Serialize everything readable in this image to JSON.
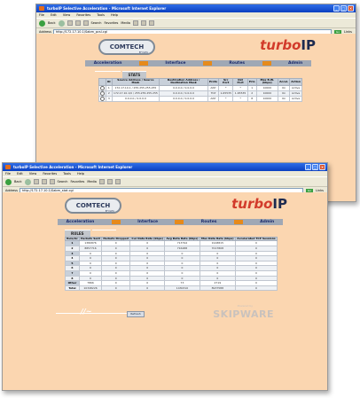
{
  "browser": {
    "title": "turboIP Selective Acceleration - Microsoft Internet Explorer",
    "menu": [
      "File",
      "Edit",
      "View",
      "Favorites",
      "Tools",
      "Help"
    ],
    "toolbar": {
      "back": "Back",
      "search": "Search",
      "favorites": "Favorites",
      "media": "Media"
    },
    "address_label": "Address",
    "go_label": "Go",
    "links_label": "Links"
  },
  "back_window": {
    "url": "http://172.17.10.1/Sabm_pcsl.cgi",
    "nav": [
      "Acceleration",
      "Interface",
      "Routes",
      "Admin"
    ],
    "tabs": [
      "RULES",
      "STATS"
    ],
    "columns": [
      "",
      "ID",
      "Source Address / Source Mask",
      "Destination Address / Destination Mask",
      "Proto",
      "Src Port",
      "Dst Port",
      "Prio",
      "Max B.W. (kbps)",
      "Accel.",
      "Action"
    ],
    "rows": [
      [
        "1",
        "172.17.10.1 / 255.255.255.255",
        "0.0.0.0 / 0.0.0.0",
        "ANY",
        "*",
        "*",
        "1",
        "10000",
        "On",
        "Active"
      ],
      [
        "2",
        "172.17.10.1/0 / 255.255.255.255",
        "0.0.0.0 / 0.0.0.0",
        "TCP",
        "1-65535",
        "1-65535",
        "2",
        "10000",
        "On",
        "Active"
      ],
      [
        "3",
        "0.0.0.0 / 0.0.0.0",
        "0.0.0.0 / 0.0.0.0",
        "ANY",
        "*",
        "*",
        "8",
        "10000",
        "On",
        "Active"
      ]
    ]
  },
  "front_window": {
    "url": "http://172.17.10.1/Sabm_stat.cgi",
    "nav": [
      "Acceleration",
      "Interface",
      "Routes",
      "Admin"
    ],
    "tabs": [
      "RULES",
      "STATS"
    ],
    "columns": [
      "Rule/Ac",
      "Packets Sent",
      "Packets Dropped",
      "Cur Data Rate (kbps)",
      "Avg Data Rate (kbps)",
      "Max Data Rate (kbps)",
      "Accelerated TCP Sessions"
    ],
    "rows": [
      [
        "1",
        "1380876",
        "0",
        "0",
        "713794",
        "1918815",
        "0"
      ],
      [
        "2",
        "8857716",
        "0",
        "0",
        "716488",
        "7017808",
        "0"
      ],
      [
        "3",
        "0",
        "0",
        "0",
        "0",
        "0",
        "0"
      ],
      [
        "4",
        "0",
        "0",
        "0",
        "0",
        "0",
        "0"
      ],
      [
        "5",
        "0",
        "0",
        "0",
        "0",
        "0",
        "0"
      ],
      [
        "6",
        "0",
        "0",
        "0",
        "0",
        "0",
        "0"
      ],
      [
        "7",
        "0",
        "0",
        "0",
        "0",
        "0",
        "0"
      ],
      [
        "8",
        "0",
        "0",
        "0",
        "0",
        "0",
        "0"
      ],
      [
        "Other",
        "7866",
        "0",
        "0",
        "73",
        "2719",
        "0"
      ],
      [
        "Total",
        "10348226",
        "0",
        "0",
        "1430310",
        "8937588",
        "0"
      ]
    ],
    "refresh_label": "Refresh",
    "brand": {
      "comtech": "COMTECH",
      "comtech_sub": "EF DATA",
      "turbo_a": "turbo",
      "turbo_b": "IP",
      "skipware_pre": "Powered by",
      "skipware": "SKIPWARE"
    }
  }
}
